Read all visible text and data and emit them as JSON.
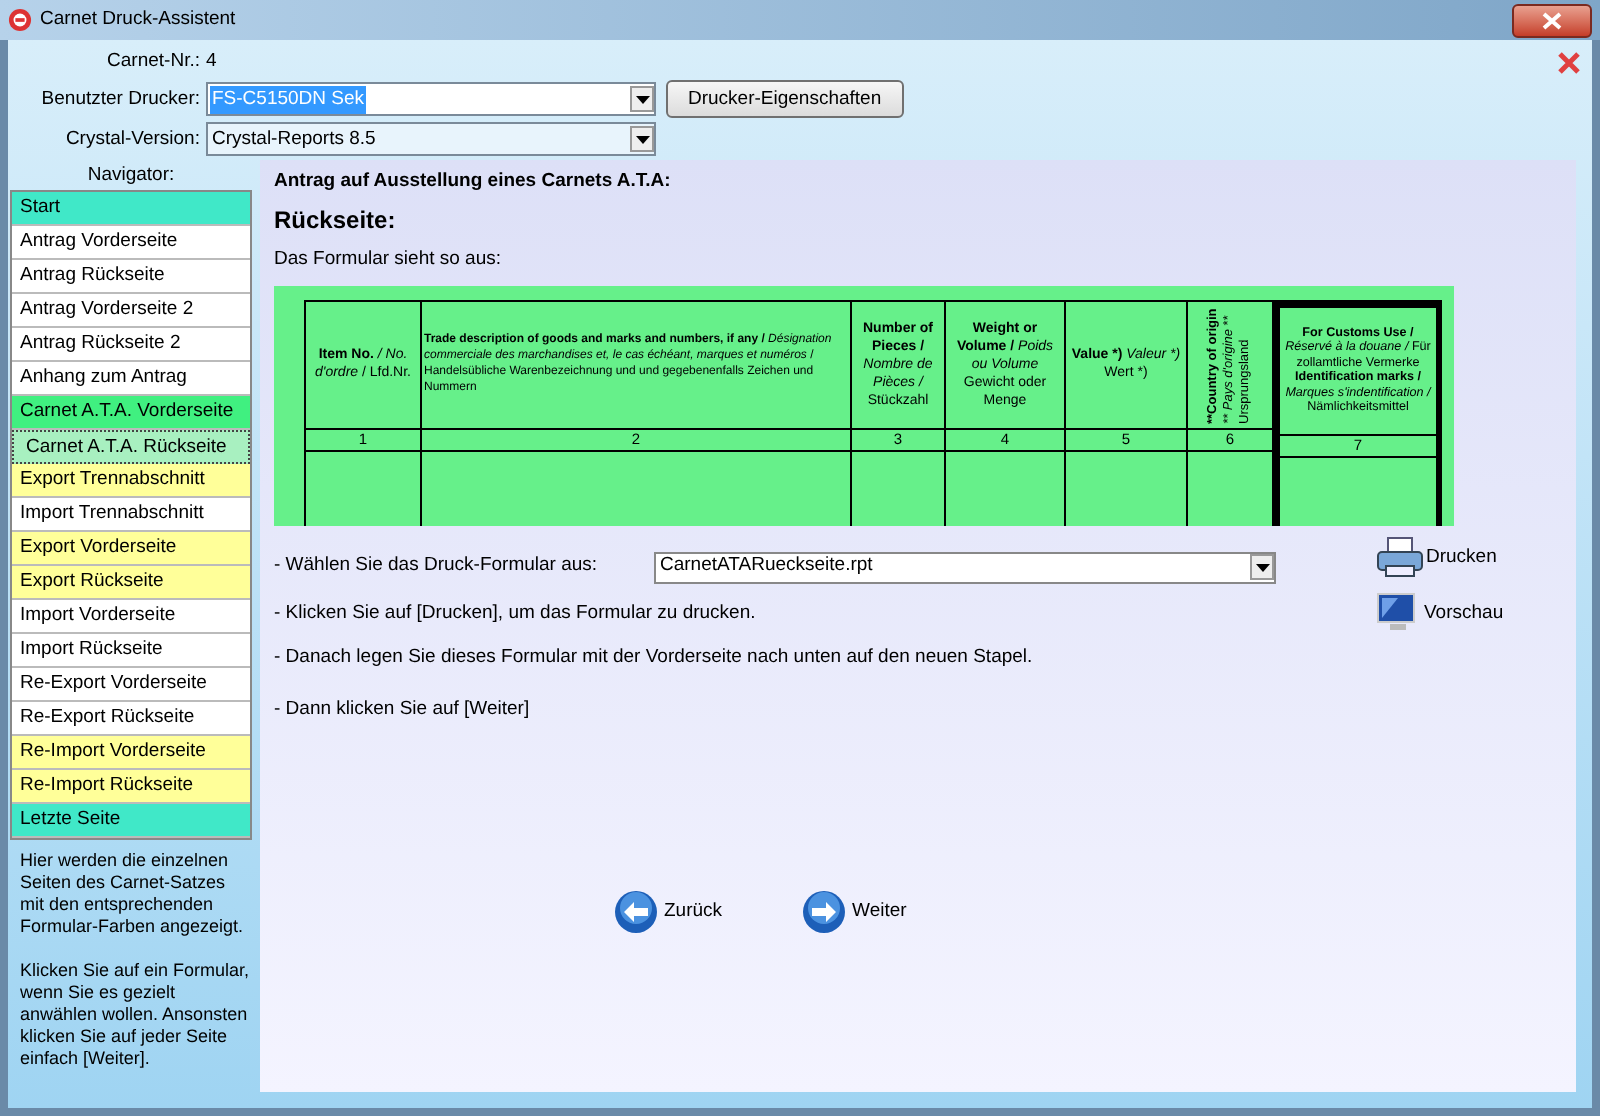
{
  "window": {
    "title": "Carnet Druck-Assistent"
  },
  "header": {
    "carnet_label": "Carnet-Nr.:",
    "carnet_value": "4",
    "printer_label": "Benutzter Drucker:",
    "printer_value": "FS-C5150DN Sek",
    "printer_button": "Drucker-Eigenschaften",
    "crystal_label": "Crystal-Version:",
    "crystal_value": "Crystal-Reports 8.5"
  },
  "navigator": {
    "title": "Navigator:",
    "items": [
      {
        "label": "Start",
        "color": "#40e8c8",
        "selected": false
      },
      {
        "label": "Antrag Vorderseite",
        "color": "#ffffff",
        "selected": false
      },
      {
        "label": "Antrag Rückseite",
        "color": "#ffffff",
        "selected": false
      },
      {
        "label": "Antrag Vorderseite 2",
        "color": "#ffffff",
        "selected": false
      },
      {
        "label": "Antrag Rückseite 2",
        "color": "#ffffff",
        "selected": false
      },
      {
        "label": "Anhang zum Antrag",
        "color": "#ffffff",
        "selected": false
      },
      {
        "label": "Carnet A.T.A. Vorderseite",
        "color": "#40f080",
        "selected": false
      },
      {
        "label": "Carnet A.T.A. Rückseite",
        "color": "#a8f0c0",
        "selected": true
      },
      {
        "label": "Export Trennabschnitt",
        "color": "#ffff99",
        "selected": false
      },
      {
        "label": "Import Trennabschnitt",
        "color": "#ffffff",
        "selected": false
      },
      {
        "label": "Export Vorderseite",
        "color": "#ffff99",
        "selected": false
      },
      {
        "label": "Export Rückseite",
        "color": "#ffff99",
        "selected": false
      },
      {
        "label": "Import Vorderseite",
        "color": "#ffffff",
        "selected": false
      },
      {
        "label": "Import Rückseite",
        "color": "#ffffff",
        "selected": false
      },
      {
        "label": "Re-Export Vorderseite",
        "color": "#ffffff",
        "selected": false
      },
      {
        "label": "Re-Export Rückseite",
        "color": "#ffffff",
        "selected": false
      },
      {
        "label": "Re-Import Vorderseite",
        "color": "#ffff99",
        "selected": false
      },
      {
        "label": "Re-Import Rückseite",
        "color": "#ffff99",
        "selected": false
      },
      {
        "label": "Letzte Seite",
        "color": "#40e8c8",
        "selected": false
      }
    ],
    "help": [
      "Hier werden die einzelnen Seiten des Carnet-Satzes mit den entsprechenden Formular-Farben angezeigt.",
      "Klicken Sie auf ein Formular, wenn Sie es gezielt anwählen wollen. Ansonsten klicken Sie auf jeder Seite einfach [Weiter]."
    ]
  },
  "main": {
    "heading": "Antrag auf Ausstellung eines Carnets A.T.A:",
    "subheading": "Rückseite:",
    "intro": "Das Formular sieht so aus:",
    "form": {
      "columns": [
        {
          "number": "1",
          "vertical": false,
          "emphasis": false,
          "parts": [
            {
              "text": "Item No.",
              "kind": "bold"
            },
            {
              "text": " / No. d'ordre",
              "kind": "italic"
            },
            {
              "text": " / Lfd.Nr.",
              "kind": "plain"
            }
          ]
        },
        {
          "number": "2",
          "vertical": false,
          "emphasis": false,
          "parts": [
            {
              "text": "Trade description of goods and marks and numbers, if any /",
              "kind": "bold"
            },
            {
              "text": " Désignation commerciale des marchandises et, le cas échéant, marques et numéros",
              "kind": "italic"
            },
            {
              "text": " / Handelsübliche Warenbezeichnung und und gegebenenfalls Zeichen und Nummern",
              "kind": "plain"
            }
          ]
        },
        {
          "number": "3",
          "vertical": false,
          "emphasis": false,
          "parts": [
            {
              "text": "Number of Pieces /",
              "kind": "bold"
            },
            {
              "text": " Nombre de Pièces /",
              "kind": "italic"
            },
            {
              "text": " Stückzahl",
              "kind": "plain"
            }
          ]
        },
        {
          "number": "4",
          "vertical": false,
          "emphasis": false,
          "parts": [
            {
              "text": "Weight or Volume /",
              "kind": "bold"
            },
            {
              "text": " Poids ou Volume",
              "kind": "italic"
            },
            {
              "text": " Gewicht oder Menge",
              "kind": "plain"
            }
          ]
        },
        {
          "number": "5",
          "vertical": false,
          "emphasis": false,
          "parts": [
            {
              "text": "Value *)",
              "kind": "bold"
            },
            {
              "text": " Valeur *)",
              "kind": "italic"
            },
            {
              "text": " Wert *)",
              "kind": "plain"
            }
          ]
        },
        {
          "number": "6",
          "vertical": true,
          "emphasis": false,
          "parts": [
            {
              "text": "**Country of origin",
              "kind": "bold"
            },
            {
              "text": " ** Pays d'origine",
              "kind": "italic"
            },
            {
              "text": " ** Ursprungsland",
              "kind": "plain"
            }
          ]
        },
        {
          "number": "7",
          "vertical": false,
          "emphasis": true,
          "parts": [
            {
              "text": "For Customs Use /",
              "kind": "bold"
            },
            {
              "text": " Réservé à la douane /",
              "kind": "italic"
            },
            {
              "text": " Für zollamtliche Vermerke",
              "kind": "plain"
            },
            {
              "text": " Identification marks /",
              "kind": "bold"
            },
            {
              "text": " Marques s'indentification /",
              "kind": "italic"
            },
            {
              "text": " Nämlichkeitsmittel",
              "kind": "plain"
            }
          ]
        }
      ]
    },
    "select_label": "- Wählen Sie das Druck-Formular aus:",
    "select_value": "CarnetATARueckseite.rpt",
    "steps": [
      "- Klicken Sie auf [Drucken], um das Formular zu drucken.",
      "- Danach legen Sie dieses Formular mit der Vorderseite nach unten auf den neuen Stapel.",
      "- Dann klicken Sie auf [Weiter]"
    ],
    "print_button": "Drucken",
    "preview_button": "Vorschau",
    "back_button": "Zurück",
    "next_button": "Weiter"
  }
}
